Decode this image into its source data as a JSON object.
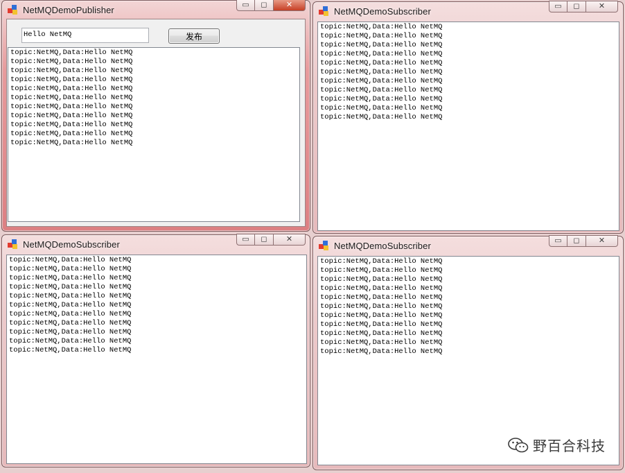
{
  "colors": {
    "desktop": "#e7cfcf",
    "listbox_bg": "#ffffff",
    "title_text": "#1b1b1b"
  },
  "publisher": {
    "title": "NetMQDemoPublisher",
    "message_input_value": "Hello NetMQ",
    "publish_button_label": "发布",
    "messages": [
      "topic:NetMQ,Data:Hello NetMQ",
      "topic:NetMQ,Data:Hello NetMQ",
      "topic:NetMQ,Data:Hello NetMQ",
      "topic:NetMQ,Data:Hello NetMQ",
      "topic:NetMQ,Data:Hello NetMQ",
      "topic:NetMQ,Data:Hello NetMQ",
      "topic:NetMQ,Data:Hello NetMQ",
      "topic:NetMQ,Data:Hello NetMQ",
      "topic:NetMQ,Data:Hello NetMQ",
      "topic:NetMQ,Data:Hello NetMQ",
      "topic:NetMQ,Data:Hello NetMQ"
    ]
  },
  "subscribers": [
    {
      "title": "NetMQDemoSubscriber",
      "messages": [
        "topic:NetMQ,Data:Hello NetMQ",
        "topic:NetMQ,Data:Hello NetMQ",
        "topic:NetMQ,Data:Hello NetMQ",
        "topic:NetMQ,Data:Hello NetMQ",
        "topic:NetMQ,Data:Hello NetMQ",
        "topic:NetMQ,Data:Hello NetMQ",
        "topic:NetMQ,Data:Hello NetMQ",
        "topic:NetMQ,Data:Hello NetMQ",
        "topic:NetMQ,Data:Hello NetMQ",
        "topic:NetMQ,Data:Hello NetMQ",
        "topic:NetMQ,Data:Hello NetMQ"
      ]
    },
    {
      "title": "NetMQDemoSubscriber",
      "messages": [
        "topic:NetMQ,Data:Hello NetMQ",
        "topic:NetMQ,Data:Hello NetMQ",
        "topic:NetMQ,Data:Hello NetMQ",
        "topic:NetMQ,Data:Hello NetMQ",
        "topic:NetMQ,Data:Hello NetMQ",
        "topic:NetMQ,Data:Hello NetMQ",
        "topic:NetMQ,Data:Hello NetMQ",
        "topic:NetMQ,Data:Hello NetMQ",
        "topic:NetMQ,Data:Hello NetMQ",
        "topic:NetMQ,Data:Hello NetMQ",
        "topic:NetMQ,Data:Hello NetMQ"
      ]
    },
    {
      "title": "NetMQDemoSubscriber",
      "messages": [
        "topic:NetMQ,Data:Hello NetMQ",
        "topic:NetMQ,Data:Hello NetMQ",
        "topic:NetMQ,Data:Hello NetMQ",
        "topic:NetMQ,Data:Hello NetMQ",
        "topic:NetMQ,Data:Hello NetMQ",
        "topic:NetMQ,Data:Hello NetMQ",
        "topic:NetMQ,Data:Hello NetMQ",
        "topic:NetMQ,Data:Hello NetMQ",
        "topic:NetMQ,Data:Hello NetMQ",
        "topic:NetMQ,Data:Hello NetMQ",
        "topic:NetMQ,Data:Hello NetMQ"
      ]
    }
  ],
  "window_controls": {
    "minimize": "▭",
    "maximize": "◻",
    "close": "✕"
  },
  "watermark": {
    "text": "野百合科技",
    "icon": "wechat-icon"
  }
}
